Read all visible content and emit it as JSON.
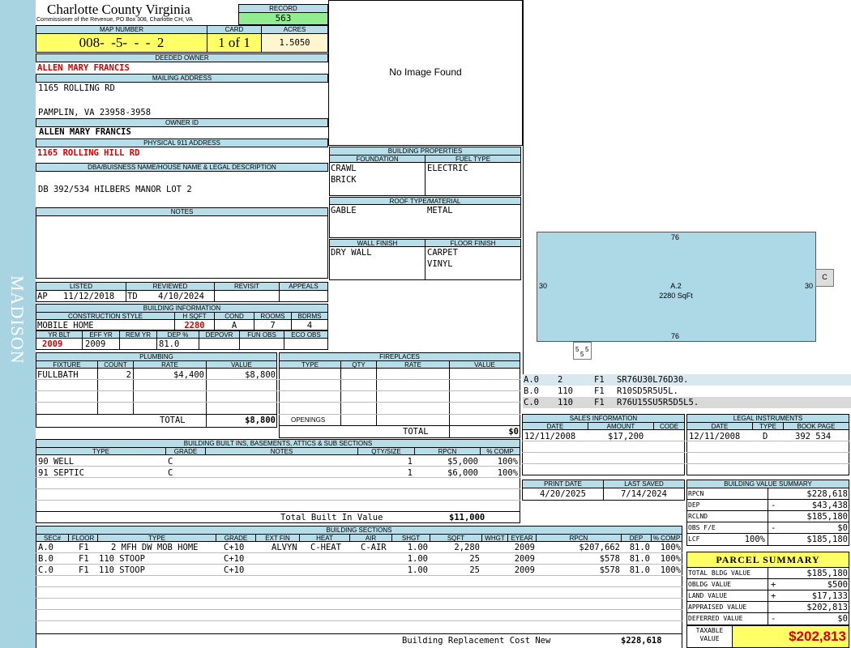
{
  "side_label": "MADISON",
  "header": {
    "county": "Charlotte County Virginia",
    "commissioner": "Commissioner of the Revenue, PO Box 308, Charlotte CH, VA",
    "record_label": "RECORD",
    "record": "563",
    "map_label": "MAP NUMBER",
    "map_number": "008-  -5-  -  -  2",
    "card_label": "CARD",
    "card": "1 of 1",
    "acres_label": "ACRES",
    "acres": "1.5050"
  },
  "owner": {
    "deeded_label": "DEEDED OWNER",
    "deeded": "ALLEN MARY FRANCIS",
    "mailing_label": "MAILING ADDRESS",
    "mail1": "1165 ROLLING RD",
    "mail2": "PAMPLIN, VA 23958-3958",
    "ownerid_label": "OWNER ID",
    "ownerid": "ALLEN MARY FRANCIS",
    "physical_label": "PHYSICAL 911 ADDRESS",
    "physical": "1165 ROLLING HILL RD",
    "dba_label": "DBA/BUISNESS NAME/HOUSE NAME & LEGAL DESCRIPTION",
    "legal": "DB 392/534 HILBERS MANOR LOT 2",
    "notes_label": "NOTES"
  },
  "image": {
    "none": "No Image Found"
  },
  "props": {
    "title": "BUILDING PROPERTIES",
    "foundation_label": "FOUNDATION",
    "fuel_label": "FUEL TYPE",
    "foundation1": "CRAWL",
    "foundation2": "BRICK",
    "fuel": "ELECTRIC",
    "roof_label": "ROOF TYPE/MATERIAL",
    "roof_type": "GABLE",
    "roof_mat": "METAL",
    "wall_label": "WALL FINISH",
    "floor_label": "FLOOR FINISH",
    "wall": "DRY WALL",
    "floor1": "CARPET",
    "floor2": "VINYL"
  },
  "status": {
    "listed_label": "LISTED",
    "reviewed_label": "REVIEWED",
    "revisit_label": "REVISIT",
    "appeals_label": "APPEALS",
    "listed_code": "AP",
    "listed_date": "11/12/2018",
    "reviewed_code": "TD",
    "reviewed_date": "4/10/2024"
  },
  "bldg": {
    "title": "BUILDING INFORMATION",
    "style_label": "CONSTRUCTION STYLE",
    "hsqft_label": "H SQFT",
    "cond_label": "COND",
    "rooms_label": "ROOMS",
    "bdrms_label": "BDRMS",
    "style": "MOBILE HOME",
    "hsqft": "2280",
    "cond": "A",
    "rooms": "7",
    "bdrms": "4",
    "yrblt_label": "YR BLT",
    "effyr_label": "EFF YR",
    "remyr_label": "REM YR",
    "dep_label": "DEP %",
    "depovr_label": "DEPOVR",
    "funobs_label": "FUN OBS",
    "ecoobs_label": "ECO OBS",
    "yrblt": "2009",
    "effyr": "2009",
    "dep": "81.0"
  },
  "plumbing": {
    "title": "PLUMBING",
    "col_fixture": "FIXTURE",
    "col_count": "COUNT",
    "col_rate": "RATE",
    "col_value": "VALUE",
    "rows": [
      {
        "fixture": "FULLBATH",
        "count": "2",
        "rate": "$4,400",
        "value": "$8,800"
      }
    ],
    "total_label": "TOTAL",
    "total": "$8,800"
  },
  "fireplaces": {
    "title": "FIREPLACES",
    "col_type": "TYPE",
    "col_qty": "QTY",
    "col_rate": "RATE",
    "col_value": "VALUE",
    "openings_label": "OPENINGS",
    "total_label": "TOTAL",
    "total": "$0"
  },
  "builtins": {
    "title": "BUILDING BUILT INS, BASEMENTS, ATTICS & SUB SECTIONS",
    "col_type": "TYPE",
    "col_grade": "GRADE",
    "col_notes": "NOTES",
    "col_qty": "QTY/SIZE",
    "col_rpcn": "RPCN",
    "col_comp": "% COMP",
    "rows": [
      {
        "type": "90 WELL",
        "grade": "C",
        "qty": "1",
        "rpcn": "$5,000",
        "comp": "100%"
      },
      {
        "type": "91 SEPTIC",
        "grade": "C",
        "qty": "1",
        "rpcn": "$6,000",
        "comp": "100%"
      }
    ],
    "total_label": "Total Built In Value",
    "total": "$11,000"
  },
  "sections": {
    "title": "BUILDING SECTIONS",
    "col_sec": "SEC#",
    "col_floor": "FLOOR",
    "col_type": "TYPE",
    "col_grade": "GRADE",
    "col_extfin": "EXT FIN",
    "col_heat": "HEAT",
    "col_air": "AIR",
    "col_shgt": "SHGT",
    "col_sqft": "SQFT",
    "col_whgt": "WHGT",
    "col_eyear": "EYEAR",
    "col_rpcn": "RPCN",
    "col_dep": "DEP",
    "col_comp": "% COMP",
    "rows": [
      {
        "sec": "A.0",
        "floor": "F1",
        "type": "2 MFH DW MOB HOME",
        "grade": "C+10",
        "extfin": "ALVYN",
        "heat": "C-HEAT",
        "air": "C-AIR",
        "shgt": "1.00",
        "sqft": "2,280",
        "eyear": "2009",
        "rpcn": "$207,662",
        "dep": "81.0",
        "comp": "100%"
      },
      {
        "sec": "B.0",
        "floor": "F1",
        "type": "110 STOOP",
        "grade": "C+10",
        "extfin": "",
        "heat": "",
        "air": "",
        "shgt": "1.00",
        "sqft": "25",
        "eyear": "2009",
        "rpcn": "$578",
        "dep": "81.0",
        "comp": "100%"
      },
      {
        "sec": "C.0",
        "floor": "F1",
        "type": "110 STOOP",
        "grade": "C+10",
        "extfin": "",
        "heat": "",
        "air": "",
        "shgt": "1.00",
        "sqft": "25",
        "eyear": "2009",
        "rpcn": "$578",
        "dep": "81.0",
        "comp": "100%"
      }
    ],
    "brcn_label": "Building Replacement Cost New",
    "brcn": "$228,618"
  },
  "sketch": {
    "top": "76",
    "bottom": "76",
    "left": "30",
    "right": "30",
    "label": "A.2",
    "area": "2280 SqFt",
    "side_c": "C",
    "stoop_left": "5",
    "stoop_right": "5",
    "stoop_bottom": "5"
  },
  "sketch_codes": [
    {
      "sec": "A.0",
      "v1": "2",
      "fl": "F1",
      "code": "SR76U30L76D30."
    },
    {
      "sec": "B.0",
      "v1": "110",
      "fl": "F1",
      "code": "R10SD5R5U5L."
    },
    {
      "sec": "C.0",
      "v1": "110",
      "fl": "F1",
      "code": "R76U15SU5R5D5L5."
    }
  ],
  "sales": {
    "title": "SALES INFORMATION",
    "col_date": "DATE",
    "col_amount": "AMOUNT",
    "col_code": "CODE",
    "date": "12/11/2008",
    "amount": "$17,200"
  },
  "legal_inst": {
    "title": "LEGAL INSTRUMENTS",
    "col_date": "DATE",
    "col_type": "TYPE",
    "col_book": "BOOK PAGE",
    "date": "12/11/2008",
    "type": "D",
    "book": "392 534"
  },
  "dates": {
    "print_label": "PRINT DATE",
    "print": "4/20/2025",
    "saved_label": "LAST SAVED",
    "saved": "7/14/2024"
  },
  "bvs": {
    "title": "BUILDING VALUE SUMMARY",
    "rpcn_label": "RPCN",
    "rpcn": "$228,618",
    "dep_label": "DEP",
    "dep_sign": "-",
    "dep": "$43,438",
    "rclnd_label": "RCLND",
    "rclnd": "$185,180",
    "obs_label": "OBS F/E",
    "obs_sign": "-",
    "obs": "$0",
    "lcf_label": "LCF",
    "lcf_pct": "100%",
    "lcf": "$185,180"
  },
  "parcel": {
    "title": "PARCEL SUMMARY",
    "bldg_label": "TOTAL BLDG VALUE",
    "bldg": "$185,180",
    "obldg_label": "OBLDG VALUE",
    "obldg_sign": "+",
    "obldg": "$500",
    "land_label": "LAND VALUE",
    "land_sign": "+",
    "land": "$17,133",
    "appraised_label": "APPRAISED VALUE",
    "appraised": "$202,813",
    "deferred_label": "DEFERRED VALUE",
    "deferred_sign": "-",
    "deferred": "$0",
    "taxable_label1": "TAXABLE",
    "taxable_label2": "VALUE",
    "taxable": "$202,813"
  },
  "colors": {
    "header_bg": "#b7dde8",
    "side_bg": "#a8d3e0",
    "map_bg": "#ffff66",
    "record_bg": "#90ee90",
    "red": "#d40000",
    "sketch_fill": "#add8e6"
  }
}
